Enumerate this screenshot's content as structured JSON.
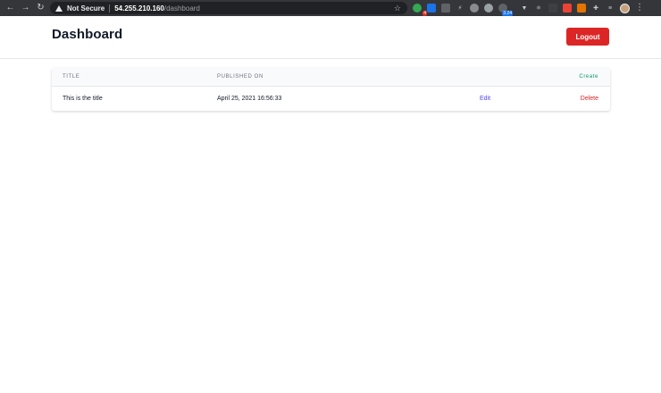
{
  "browser": {
    "back_glyph": "←",
    "forward_glyph": "→",
    "reload_glyph": "↻",
    "security_label": "Not Secure",
    "url_host": "54.255.210.160",
    "url_path": "/dashboard",
    "star_glyph": "☆",
    "menu_glyph": "⋮",
    "extension_badges": {
      "badge_one": "4",
      "badge_two": "3.24"
    }
  },
  "header": {
    "title": "Dashboard",
    "logout_label": "Logout"
  },
  "table": {
    "columns": {
      "title": "Title",
      "published_on": "Published On"
    },
    "create_label": "Create",
    "rows": [
      {
        "title": "This is the title",
        "published_on": "April 25, 2021 16:56:33",
        "edit_label": "Edit",
        "delete_label": "Delete"
      }
    ]
  },
  "colors": {
    "logout_bg": "#dc2626",
    "create": "#059669",
    "edit": "#4f46e5",
    "delete": "#dc2626"
  }
}
